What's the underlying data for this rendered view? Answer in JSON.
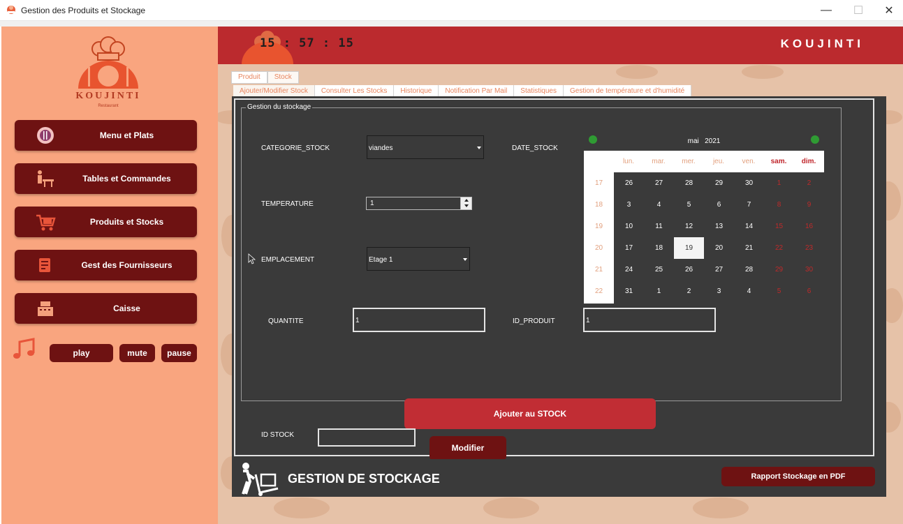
{
  "window": {
    "title": "Gestion des Produits et Stockage",
    "controls": {
      "minimize": "—",
      "maximize": "☐",
      "close": "✕"
    }
  },
  "sidebar": {
    "logo": {
      "brand": "KOUJINTI",
      "subtitle": "Restaurant"
    },
    "nav": [
      {
        "label": "Menu et Plats",
        "icon": "plate-icon"
      },
      {
        "label": "Tables et Commandes",
        "icon": "table-waiter-icon"
      },
      {
        "label": "Produits et Stocks",
        "icon": "cart-icon"
      },
      {
        "label": "Gest des Fournisseurs",
        "icon": "supplier-list-icon"
      },
      {
        "label": "Caisse",
        "icon": "cash-register-icon"
      }
    ],
    "music": {
      "play": "play",
      "mute": "mute",
      "pause": "pause"
    }
  },
  "header": {
    "clock": "15 : 57 : 15",
    "brand": "KOUJINTI"
  },
  "tabs": {
    "outer": [
      "Produit",
      "Stock"
    ],
    "outer_active": 1,
    "inner": [
      "Ajouter/Modifier Stock",
      "Consulter Les Stocks",
      "Historique",
      "Notification Par Mail",
      "Statistiques",
      "Gestion de température et d'humidité"
    ],
    "inner_active": 0
  },
  "form": {
    "group_title": "Gestion du stockage",
    "categorie": {
      "label": "CATEGORIE_STOCK",
      "value": "viandes"
    },
    "temperature": {
      "label": "TEMPERATURE",
      "value": "1"
    },
    "emplacement": {
      "label": "EMPLACEMENT",
      "value": "Etage 1"
    },
    "date_label": "DATE_STOCK",
    "quantite": {
      "label": "QUANTITE",
      "value": "1"
    },
    "id_produit": {
      "label": "ID_PRODUIT",
      "value": "1"
    },
    "add_button": "Ajouter au STOCK",
    "id_stock": {
      "label": "ID STOCK",
      "value": ""
    },
    "modify_button": "Modifier"
  },
  "calendar": {
    "month": "mai",
    "year": "2021",
    "weekdays": [
      "lun.",
      "mar.",
      "mer.",
      "jeu.",
      "ven.",
      "sam.",
      "dim."
    ],
    "weeks": [
      "17",
      "18",
      "19",
      "20",
      "21",
      "22"
    ],
    "days": [
      [
        "26",
        "27",
        "28",
        "29",
        "30",
        "1",
        "2"
      ],
      [
        "3",
        "4",
        "5",
        "6",
        "7",
        "8",
        "9"
      ],
      [
        "10",
        "11",
        "12",
        "13",
        "14",
        "15",
        "16"
      ],
      [
        "17",
        "18",
        "19",
        "20",
        "21",
        "22",
        "23"
      ],
      [
        "24",
        "25",
        "26",
        "27",
        "28",
        "29",
        "30"
      ],
      [
        "31",
        "1",
        "2",
        "3",
        "4",
        "5",
        "6"
      ]
    ],
    "selected": "19",
    "colors": {
      "weekend": "#c0252b",
      "muted": "#e2a07e",
      "nav": "#2f9b33"
    }
  },
  "footer": {
    "title": "GESTION DE STOCKAGE",
    "pdf_button": "Rapport Stockage en PDF"
  },
  "colors": {
    "sidebar": "#f9a57f",
    "dark_red": "#6e1212",
    "header_red": "#bb2a2e",
    "panel": "#3a3a3a",
    "accent_red": "#c12d34"
  }
}
